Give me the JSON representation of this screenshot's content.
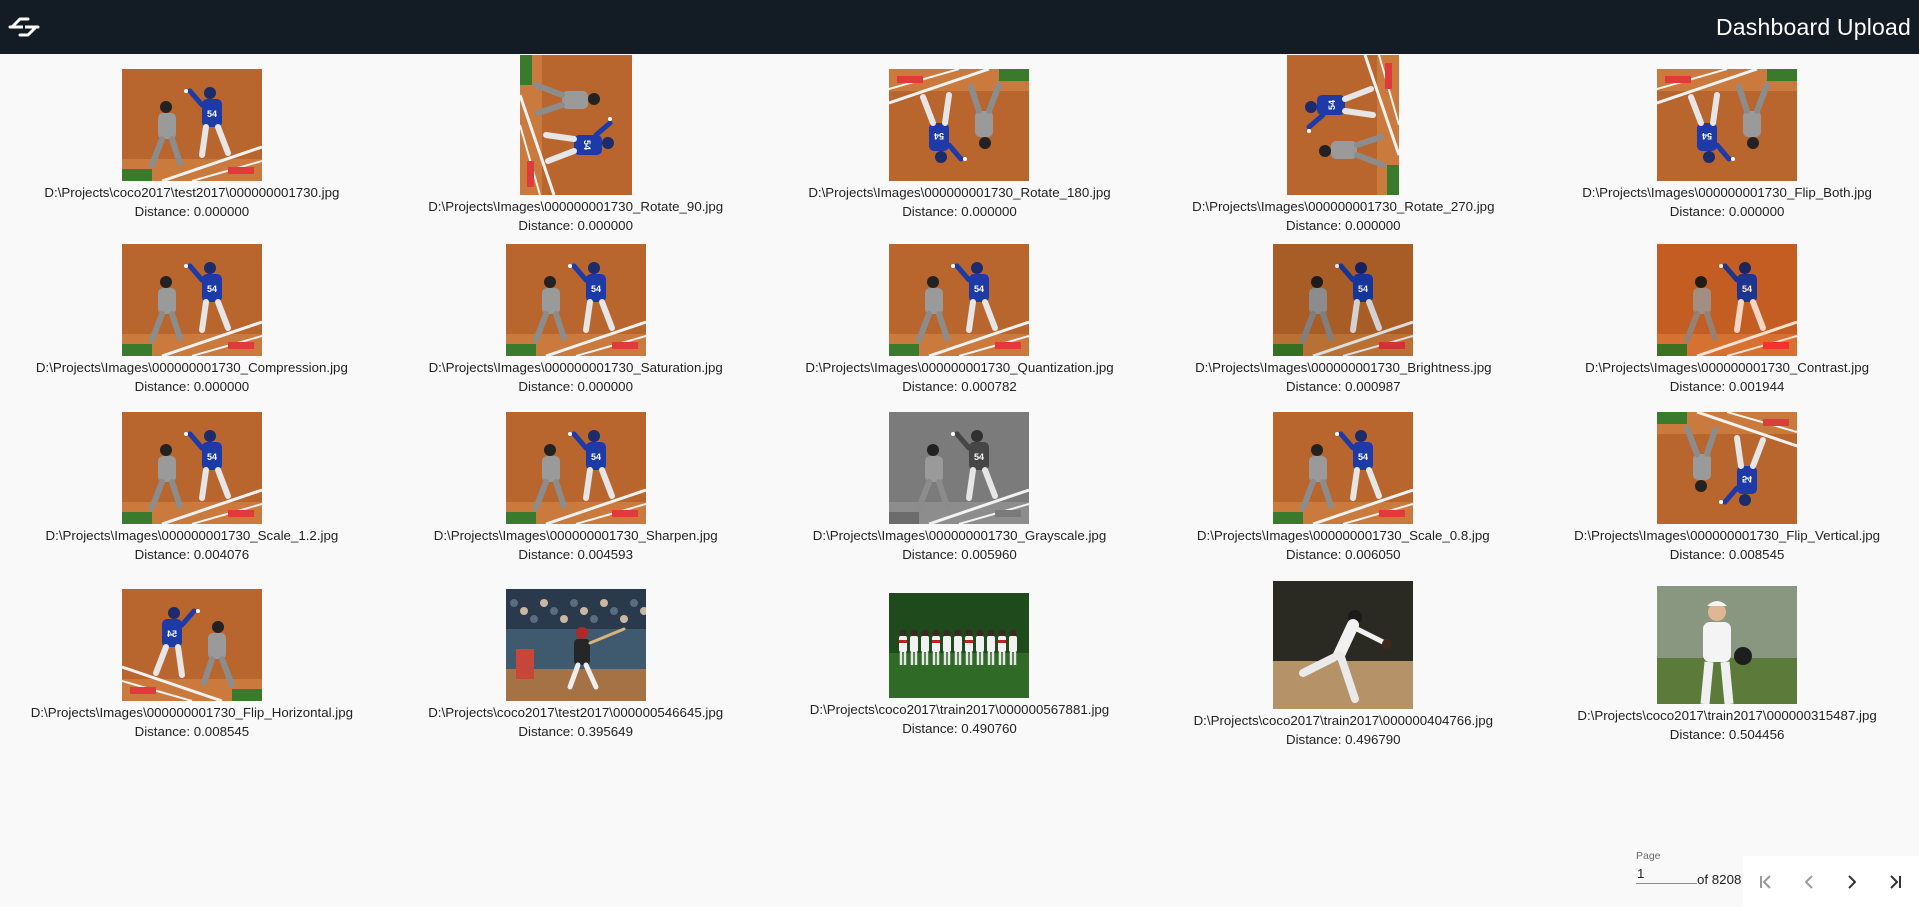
{
  "header": {
    "title": "Dashboard Upload",
    "logo_icon": "app-logo-icon",
    "background": "#131b24"
  },
  "results": [
    {
      "path": "D:\\Projects\\coco2017\\test2017\\000000001730.jpg",
      "distance": "Distance: 0.000000",
      "thumb": "field",
      "variant": "original"
    },
    {
      "path": "D:\\Projects\\Images\\000000001730_Rotate_90.jpg",
      "distance": "Distance: 0.000000",
      "thumb": "field",
      "variant": "rotate90"
    },
    {
      "path": "D:\\Projects\\Images\\000000001730_Rotate_180.jpg",
      "distance": "Distance: 0.000000",
      "thumb": "field",
      "variant": "rotate180"
    },
    {
      "path": "D:\\Projects\\Images\\000000001730_Rotate_270.jpg",
      "distance": "Distance: 0.000000",
      "thumb": "field",
      "variant": "rotate270"
    },
    {
      "path": "D:\\Projects\\Images\\000000001730_Flip_Both.jpg",
      "distance": "Distance: 0.000000",
      "thumb": "field",
      "variant": "flipboth"
    },
    {
      "path": "D:\\Projects\\Images\\000000001730_Compression.jpg",
      "distance": "Distance: 0.000000",
      "thumb": "field",
      "variant": "original"
    },
    {
      "path": "D:\\Projects\\Images\\000000001730_Saturation.jpg",
      "distance": "Distance: 0.000000",
      "thumb": "field",
      "variant": "original"
    },
    {
      "path": "D:\\Projects\\Images\\000000001730_Quantization.jpg",
      "distance": "Distance: 0.000782",
      "thumb": "field",
      "variant": "original"
    },
    {
      "path": "D:\\Projects\\Images\\000000001730_Brightness.jpg",
      "distance": "Distance: 0.000987",
      "thumb": "field",
      "variant": "dark"
    },
    {
      "path": "D:\\Projects\\Images\\000000001730_Contrast.jpg",
      "distance": "Distance: 0.001944",
      "thumb": "field",
      "variant": "contrast"
    },
    {
      "path": "D:\\Projects\\Images\\000000001730_Scale_1.2.jpg",
      "distance": "Distance: 0.004076",
      "thumb": "field",
      "variant": "original"
    },
    {
      "path": "D:\\Projects\\Images\\000000001730_Sharpen.jpg",
      "distance": "Distance: 0.004593",
      "thumb": "field",
      "variant": "original"
    },
    {
      "path": "D:\\Projects\\Images\\000000001730_Grayscale.jpg",
      "distance": "Distance: 0.005960",
      "thumb": "field",
      "variant": "gray"
    },
    {
      "path": "D:\\Projects\\Images\\000000001730_Scale_0.8.jpg",
      "distance": "Distance: 0.006050",
      "thumb": "field",
      "variant": "original"
    },
    {
      "path": "D:\\Projects\\Images\\000000001730_Flip_Vertical.jpg",
      "distance": "Distance: 0.008545",
      "thumb": "field",
      "variant": "flipv"
    },
    {
      "path": "D:\\Projects\\Images\\000000001730_Flip_Horizontal.jpg",
      "distance": "Distance: 0.008545",
      "thumb": "field",
      "variant": "fliph"
    },
    {
      "path": "D:\\Projects\\coco2017\\test2017\\000000546645.jpg",
      "distance": "Distance: 0.395649",
      "thumb": "batter",
      "variant": "original"
    },
    {
      "path": "D:\\Projects\\coco2017\\train2017\\000000567881.jpg",
      "distance": "Distance: 0.490760",
      "thumb": "team",
      "variant": "original"
    },
    {
      "path": "D:\\Projects\\coco2017\\train2017\\000000404766.jpg",
      "distance": "Distance: 0.496790",
      "thumb": "pitcher",
      "variant": "original"
    },
    {
      "path": "D:\\Projects\\coco2017\\train2017\\000000315487.jpg",
      "distance": "Distance: 0.504456",
      "thumb": "player",
      "variant": "original"
    }
  ],
  "paginator": {
    "page_label": "Page",
    "page_value": "1",
    "of_total": "of 8208",
    "first_icon": "first-page-icon",
    "prev_icon": "chevron-left-icon",
    "next_icon": "chevron-right-icon",
    "last_icon": "last-page-icon"
  }
}
